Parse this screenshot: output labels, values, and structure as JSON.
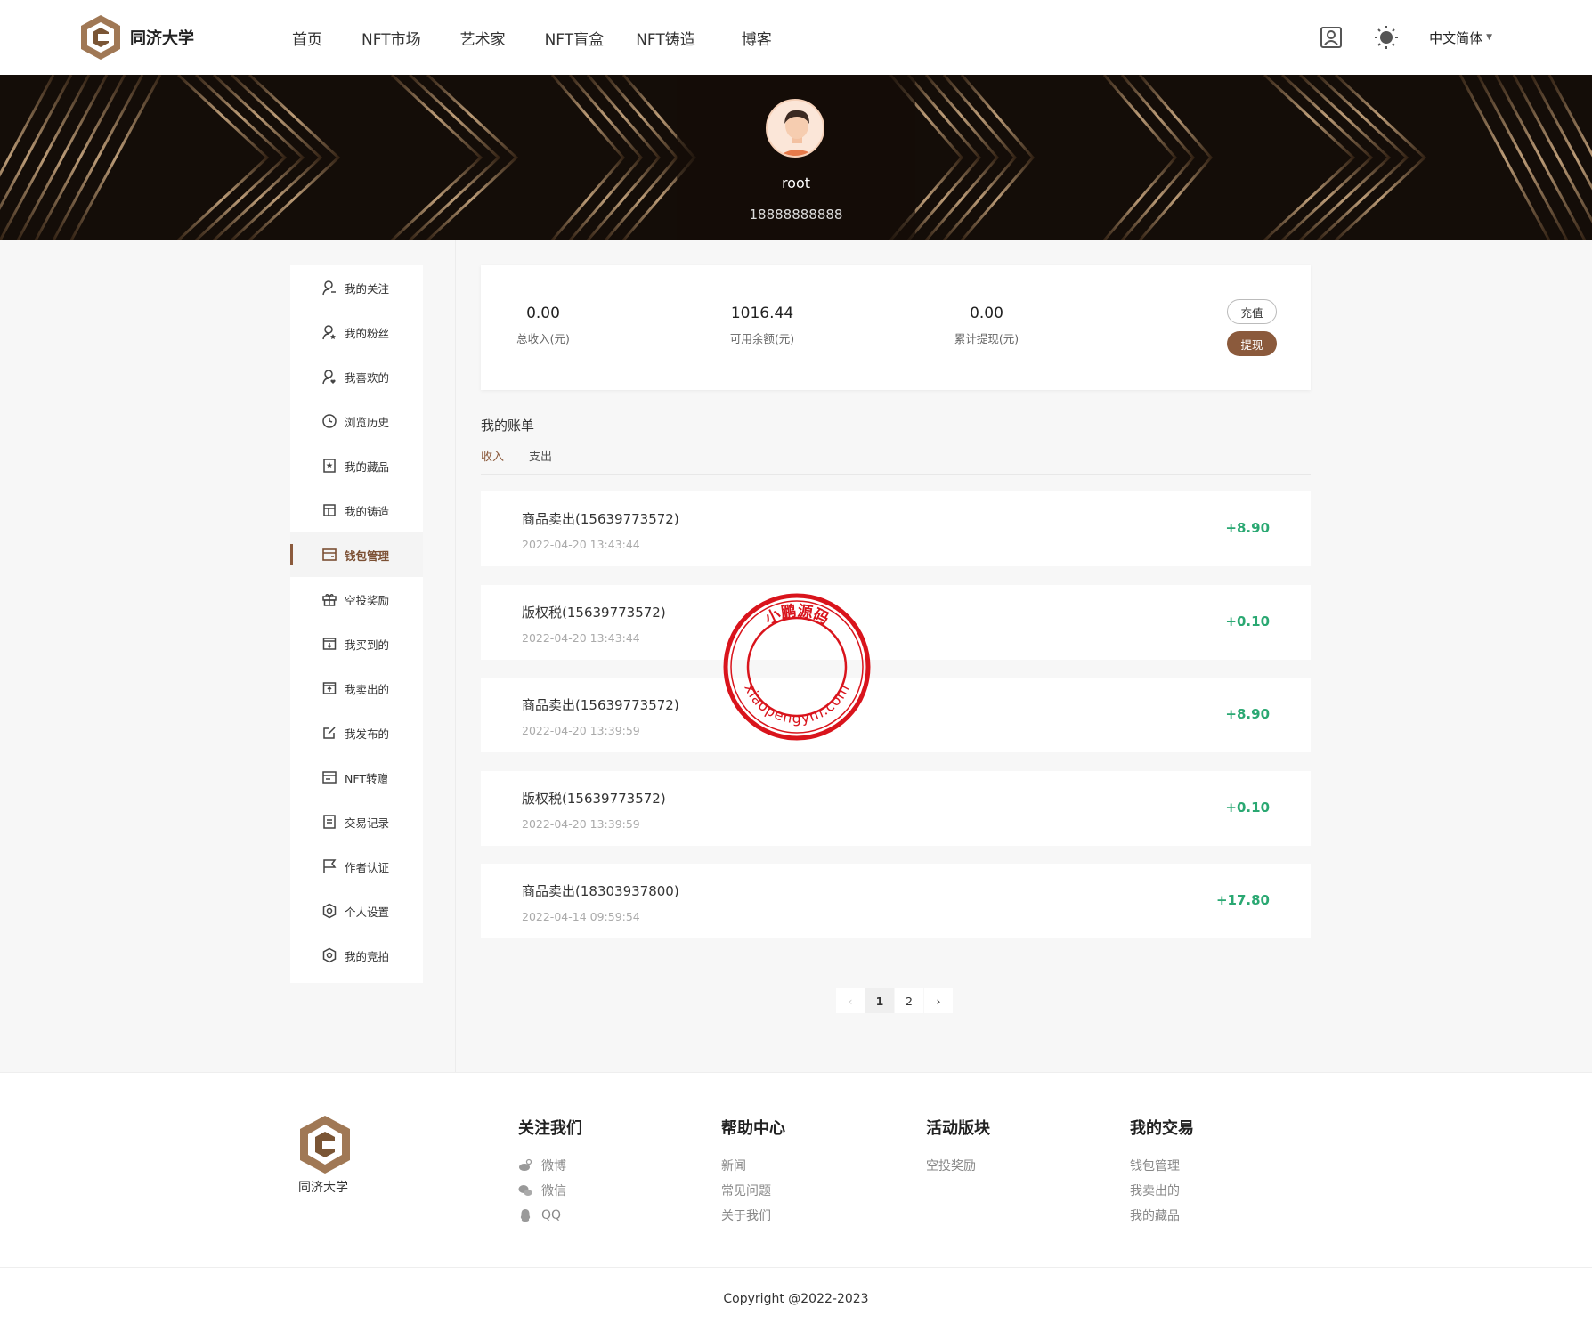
{
  "header": {
    "brand": "同济大学",
    "nav": [
      "首页",
      "NFT市场",
      "艺术家",
      "NFT盲盒",
      "NFT铸造",
      "博客"
    ],
    "language": "中文简体"
  },
  "profile": {
    "name": "root",
    "phone": "18888888888"
  },
  "sidebar": {
    "items": [
      {
        "label": "我的关注",
        "icon": "user-follow-icon"
      },
      {
        "label": "我的粉丝",
        "icon": "user-fans-icon"
      },
      {
        "label": "我喜欢的",
        "icon": "user-like-icon"
      },
      {
        "label": "浏览历史",
        "icon": "clock-icon"
      },
      {
        "label": "我的藏品",
        "icon": "bookmark-icon"
      },
      {
        "label": "我的铸造",
        "icon": "layout-icon"
      },
      {
        "label": "钱包管理",
        "icon": "wallet-icon",
        "active": true
      },
      {
        "label": "空投奖励",
        "icon": "gift-icon"
      },
      {
        "label": "我买到的",
        "icon": "download-box-icon"
      },
      {
        "label": "我卖出的",
        "icon": "upload-box-icon"
      },
      {
        "label": "我发布的",
        "icon": "edit-icon"
      },
      {
        "label": "NFT转赠",
        "icon": "card-icon"
      },
      {
        "label": "交易记录",
        "icon": "document-icon"
      },
      {
        "label": "作者认证",
        "icon": "flag-icon"
      },
      {
        "label": "个人设置",
        "icon": "settings-hex-icon"
      },
      {
        "label": "我的竞拍",
        "icon": "auction-hex-icon"
      }
    ]
  },
  "wallet": {
    "stats": [
      {
        "value": "0.00",
        "label": "总收入(元)"
      },
      {
        "value": "1016.44",
        "label": "可用余额(元)"
      },
      {
        "value": "0.00",
        "label": "累计提现(元)"
      }
    ],
    "recharge_label": "充值",
    "withdraw_label": "提现"
  },
  "bills": {
    "title": "我的账单",
    "tabs": [
      "收入",
      "支出"
    ],
    "active_tab": "收入",
    "items": [
      {
        "name": "商品卖出(15639773572)",
        "time": "2022-04-20 13:43:44",
        "amount": "+8.90"
      },
      {
        "name": "版权税(15639773572)",
        "time": "2022-04-20 13:43:44",
        "amount": "+0.10"
      },
      {
        "name": "商品卖出(15639773572)",
        "time": "2022-04-20 13:39:59",
        "amount": "+8.90"
      },
      {
        "name": "版权税(15639773572)",
        "time": "2022-04-20 13:39:59",
        "amount": "+0.10"
      },
      {
        "name": "商品卖出(18303937800)",
        "time": "2022-04-14 09:59:54",
        "amount": "+17.80"
      }
    ]
  },
  "pagination": {
    "pages": [
      "1",
      "2"
    ],
    "current": "1",
    "prev": "‹",
    "next": "›"
  },
  "stamp": {
    "top_text": "小鹏源码",
    "bottom_text": "xiaopengym.com",
    "color": "#d9141c"
  },
  "footer": {
    "brand": "同济大学",
    "columns": [
      {
        "title": "关注我们",
        "links": [
          {
            "label": "微博",
            "icon": "weibo-icon"
          },
          {
            "label": "微信",
            "icon": "wechat-icon"
          },
          {
            "label": "QQ",
            "icon": "qq-icon"
          }
        ]
      },
      {
        "title": "帮助中心",
        "links": [
          {
            "label": "新闻"
          },
          {
            "label": "常见问题"
          },
          {
            "label": "关于我们"
          }
        ]
      },
      {
        "title": "活动版块",
        "links": [
          {
            "label": "空投奖励"
          }
        ]
      },
      {
        "title": "我的交易",
        "links": [
          {
            "label": "钱包管理"
          },
          {
            "label": "我卖出的"
          },
          {
            "label": "我的藏品"
          }
        ]
      }
    ],
    "copyright": "Copyright @2022-2023"
  },
  "colors": {
    "accent": "#8b5a3c",
    "income": "#2aa872"
  }
}
